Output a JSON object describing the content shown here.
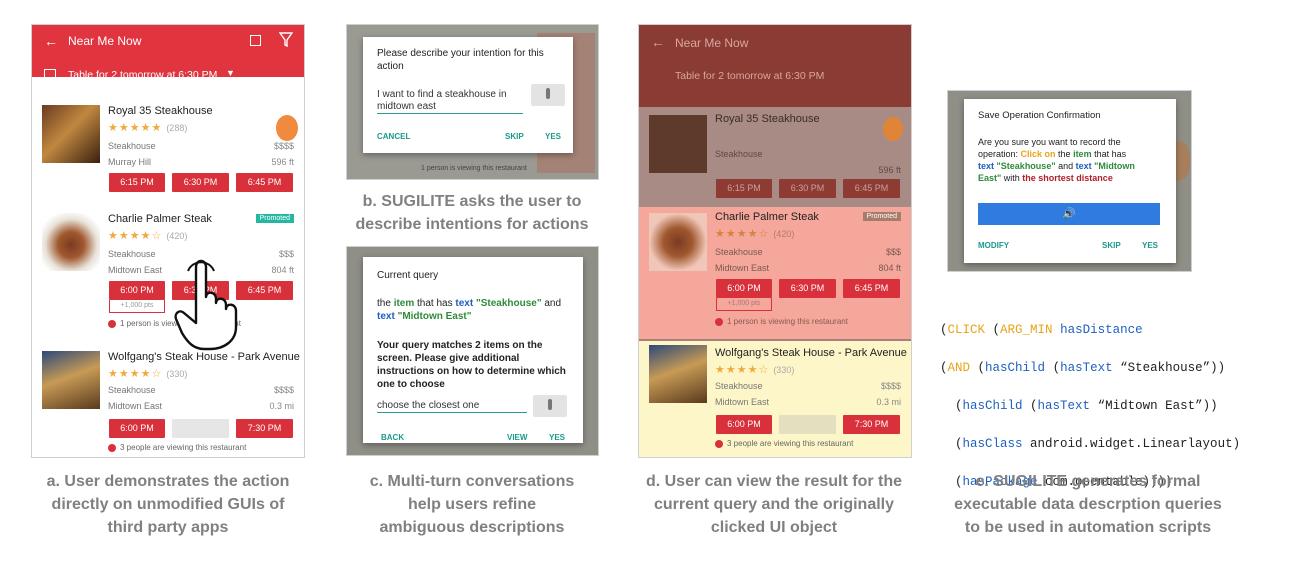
{
  "colors": {
    "app_red": "#e0343f",
    "highlight_red": "#f4a79a",
    "highlight_yellow": "#fdf6c9",
    "teal": "#1a9a8a",
    "orange": "#e8a317",
    "blue": "#1f5fbf",
    "green": "#2e8b3a"
  },
  "app": {
    "title": "Near Me Now",
    "reservation": "Table for 2 tomorrow at 6:30 PM",
    "restaurants": [
      {
        "name": "Royal 35 Steakhouse",
        "rating_count": "(288)",
        "cuisine": "Steakhouse",
        "price": "$$$$",
        "area": "Murray Hill",
        "distance": "596 ft",
        "times": [
          "6:15 PM",
          "6:30 PM",
          "6:45 PM"
        ]
      },
      {
        "name": "Charlie Palmer Steak",
        "badge": "Promoted",
        "rating_count": "(420)",
        "cuisine": "Steakhouse",
        "price": "$$$",
        "area": "Midtown East",
        "distance": "804 ft",
        "times": [
          "6:00 PM",
          "6:30 PM",
          "6:45 PM"
        ],
        "slot_note": "+1,000 pts",
        "viewing": "1 person is viewing this restaurant"
      },
      {
        "name": "Wolfgang's Steak House - Park Avenue",
        "rating_count": "(330)",
        "cuisine": "Steakhouse",
        "price": "$$$$",
        "area": "Midtown East",
        "distance": "0.3 mi",
        "times": [
          "6:00 PM",
          "",
          "7:30 PM"
        ],
        "viewing": "3 people are viewing this restaurant"
      }
    ]
  },
  "panel_b": {
    "prompt": "Please describe your intention for this action",
    "input": "I want to find a steakhouse in midtown east",
    "cancel": "CANCEL",
    "skip": "SKIP",
    "yes": "YES",
    "behind": "1 person is viewing this restaurant"
  },
  "panel_c": {
    "title": "Current query",
    "q_prefix": "the ",
    "q_item": "item",
    "q_mid": " that has ",
    "q_text1": "text",
    "q_val1": "\"Steakhouse\"",
    "q_and": " and",
    "q_text2": "text",
    "q_val2": "\"Midtown East\"",
    "message": "Your query matches 2 items on the screen. Please give additional instructions on how to determine which one to choose",
    "input": "choose the closest one",
    "back": "BACK",
    "view": "VIEW",
    "yes": "YES"
  },
  "panel_e": {
    "title": "Save Operation Confirmation",
    "l1": "Are you sure you want to record the",
    "l2a": "operation: ",
    "click_on": "Click on",
    "the": " the ",
    "item": "item",
    " that_has": " that has",
    "text1": "text",
    "val1": "\"Steakhouse\"",
    "and": " and ",
    "text2": "text",
    "val2": "\"Midtown",
    "val2b": "East\"",
    "with": " with ",
    "shortest": "the shortest distance",
    "modify": "MODIFY",
    "skip": "SKIP",
    "yes": "YES"
  },
  "code": {
    "l1_open": "(",
    "l1_click": "CLICK",
    "l1_sp": " (",
    "l1_argmin": "ARG_MIN",
    "l1_has": " hasDistance",
    "l2_open": "(",
    "l2_and": "AND",
    " l2_a": " (",
    "l2_haschild": "hasChild",
    "l2_b": " (",
    "l2_hastext": "hasText",
    "l2_val": " “Steakhouse”))",
    "l3_a": "  (",
    "l3_haschild": "hasChild",
    "l3_b": " (",
    "l3_hastext": "hasText",
    "l3_val": " “Midtown East”))",
    "l4_a": "  (",
    "l4_hasclass": "hasClass",
    "l4_val": " android.widget.Linearlayout)",
    "l5_a": "  (",
    "l5_haspkg": "hasPackage",
    "l5_val": " com.opentable))))"
  },
  "captions": {
    "a": [
      "a. User demonstrates the action",
      "directly on unmodified GUIs of",
      "third party apps"
    ],
    "b": [
      "b. SUGILITE asks the user to",
      "describe intentions for actions"
    ],
    "c": [
      "c. Multi-turn conversations",
      "help users refine",
      "ambiguous descriptions"
    ],
    "d": [
      "d. User can view the result for the",
      "current query and the originally",
      "clicked UI object"
    ],
    "e": [
      "e. SUGILITE generates formal",
      "executable data descrption queries",
      "to be used in automation scripts"
    ]
  }
}
